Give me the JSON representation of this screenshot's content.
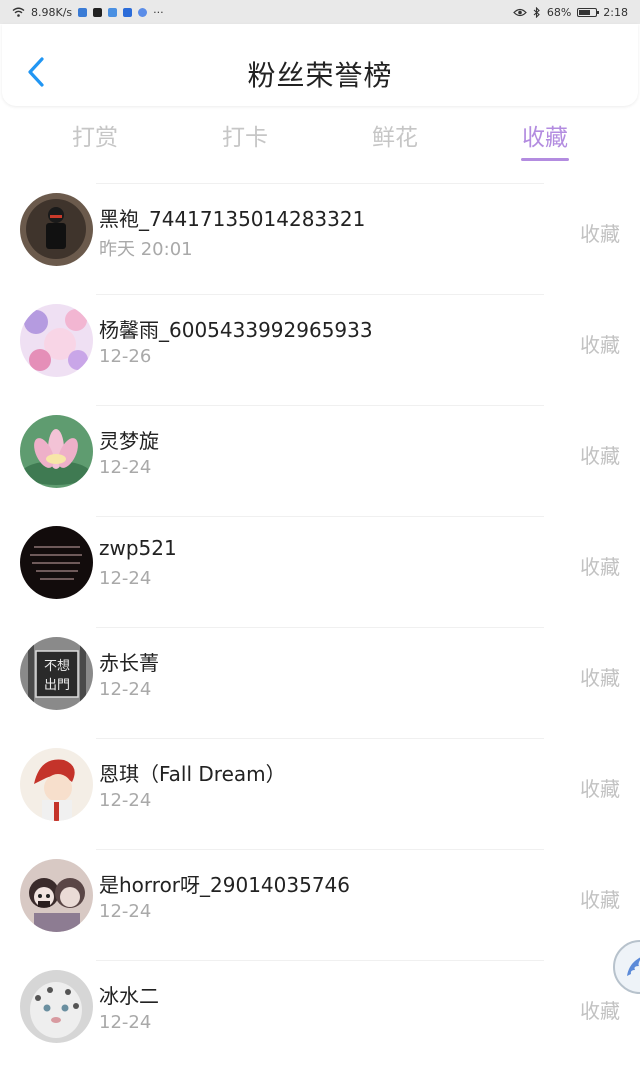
{
  "status_bar": {
    "speed": "8.98K/s",
    "extra": "···",
    "battery": "68%",
    "battery_level": 0.68,
    "time": "2:18"
  },
  "header": {
    "title": "粉丝荣誉榜"
  },
  "tabs": [
    {
      "label": "打赏",
      "active": false
    },
    {
      "label": "打卡",
      "active": false
    },
    {
      "label": "鲜花",
      "active": false
    },
    {
      "label": "收藏",
      "active": true
    }
  ],
  "list": [
    {
      "name": "黑袍_74417135014283321",
      "date": "昨天 20:01",
      "action": "收藏"
    },
    {
      "name": "杨馨雨_6005433992965933",
      "date": "12-26",
      "action": "收藏"
    },
    {
      "name": "灵梦旋",
      "date": "12-24",
      "action": "收藏"
    },
    {
      "name": "zwp521",
      "date": "12-24",
      "action": "收藏"
    },
    {
      "name": "赤长菁",
      "date": "12-24",
      "action": "收藏"
    },
    {
      "name": "恩琪（Fall Dream）",
      "date": "12-24",
      "action": "收藏"
    },
    {
      "name": "是horror呀_29014035746",
      "date": "12-24",
      "action": "收藏"
    },
    {
      "name": "冰水二",
      "date": "12-24",
      "action": "收藏"
    }
  ],
  "avatar_text": {
    "line1": "不想",
    "line2": "出門"
  },
  "colors": {
    "accent": "#b38ce0",
    "back_arrow": "#2196f3",
    "muted": "#c2c2c2"
  }
}
